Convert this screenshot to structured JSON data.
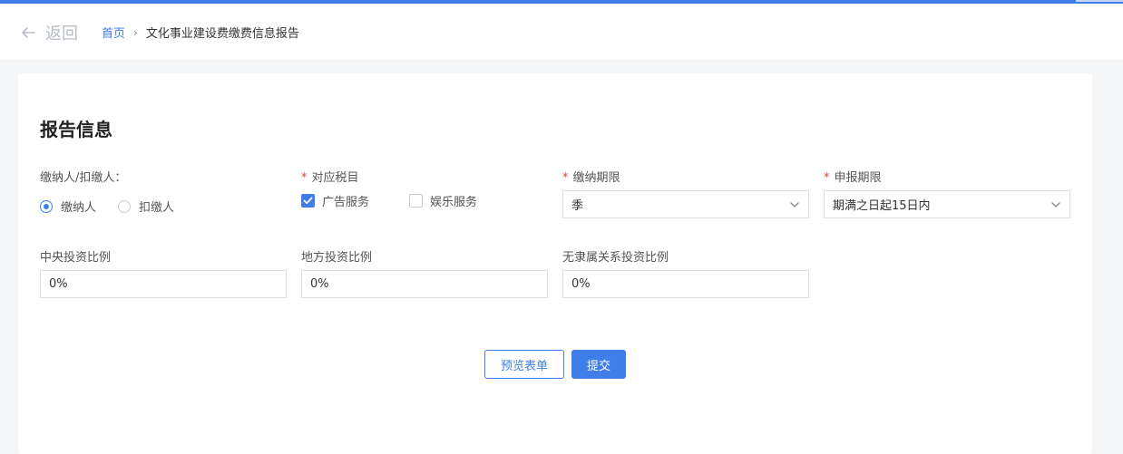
{
  "header": {
    "back_label": "返回",
    "breadcrumb": {
      "home": "首页",
      "current": "文化事业建设费缴费信息报告"
    }
  },
  "section": {
    "title": "报告信息"
  },
  "form": {
    "payer_type": {
      "label": "缴纳人/扣缴人：",
      "options": [
        {
          "label": "缴纳人",
          "selected": true
        },
        {
          "label": "扣缴人",
          "selected": false
        }
      ]
    },
    "tax_item": {
      "required_mark": "*",
      "label": "对应税目",
      "options": [
        {
          "label": "广告服务",
          "checked": true
        },
        {
          "label": "娱乐服务",
          "checked": false
        }
      ]
    },
    "payment_period": {
      "required_mark": "*",
      "label": "缴纳期限",
      "value": "季"
    },
    "filing_deadline": {
      "required_mark": "*",
      "label": "申报期限",
      "value": "期满之日起15日内"
    },
    "central_ratio": {
      "label": "中央投资比例",
      "value": "0%"
    },
    "local_ratio": {
      "label": "地方投资比例",
      "value": "0%"
    },
    "unaffiliated_ratio": {
      "label": "无隶属关系投资比例",
      "value": "0%"
    }
  },
  "actions": {
    "preview_label": "预览表单",
    "submit_label": "提交"
  },
  "colors": {
    "accent": "#3f7ee8",
    "required": "#e0443a",
    "page_bg": "#f5f6f8"
  },
  "icons": {
    "back": "arrow-left-icon",
    "breadcrumb_sep": "chevron-right-icon",
    "select": "chevron-down-icon",
    "check": "checkmark-icon"
  }
}
